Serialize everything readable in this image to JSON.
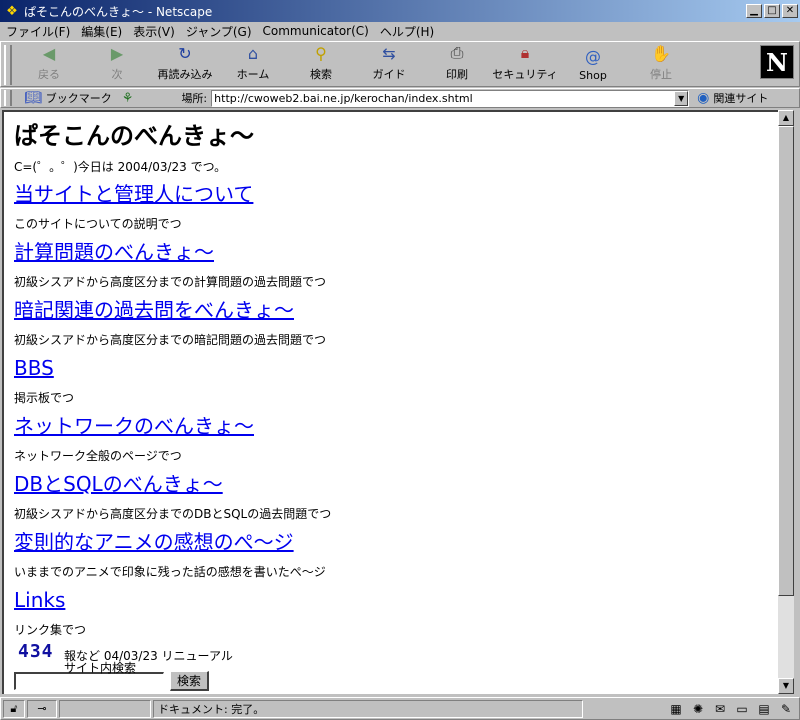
{
  "window": {
    "title": "ぱそこんのべんきょ～ - Netscape"
  },
  "menu": {
    "items": [
      "ファイル(F)",
      "編集(E)",
      "表示(V)",
      "ジャンプ(G)",
      "Communicator(C)",
      "ヘルプ(H)"
    ]
  },
  "toolbar": {
    "buttons": [
      {
        "label": "戻る",
        "icon": "back-arrow-icon",
        "enabled": false
      },
      {
        "label": "次",
        "icon": "forward-arrow-icon",
        "enabled": false
      },
      {
        "label": "再読み込み",
        "icon": "reload-icon",
        "enabled": true
      },
      {
        "label": "ホーム",
        "icon": "home-icon",
        "enabled": true
      },
      {
        "label": "検索",
        "icon": "search-icon",
        "enabled": true
      },
      {
        "label": "ガイド",
        "icon": "guide-icon",
        "enabled": true
      },
      {
        "label": "印刷",
        "icon": "print-icon",
        "enabled": true
      },
      {
        "label": "セキュリティ",
        "icon": "lock-icon",
        "enabled": true
      },
      {
        "label": "Shop",
        "icon": "shop-icon",
        "enabled": true
      },
      {
        "label": "停止",
        "icon": "stop-icon",
        "enabled": false
      }
    ],
    "logo_letter": "N"
  },
  "location": {
    "bookmarks_label": "ブックマーク",
    "location_label": "場所:",
    "url": "http://cwoweb2.bai.ne.jp/kerochan/index.shtml",
    "related_label": "関連サイト"
  },
  "page": {
    "title": "ぱそこんのべんきょ～",
    "date_line": "C=(゜。゜)今日は 2004/03/23 でつ。",
    "sections": [
      {
        "link": "当サイトと管理人について",
        "desc": "このサイトについての説明でつ"
      },
      {
        "link": "計算問題のべんきょ～",
        "desc": "初級シスアドから高度区分までの計算問題の過去問題でつ"
      },
      {
        "link": "暗記関連の過去問をべんきょ～",
        "desc": "初級シスアドから高度区分までの暗記問題の過去問題でつ"
      },
      {
        "link": "BBS",
        "desc": "掲示板でつ"
      },
      {
        "link": "ネットワークのべんきょ～",
        "desc": "ネットワーク全般のページでつ"
      },
      {
        "link": "DBとSQLのべんきょ～",
        "desc": "初級シスアドから高度区分までのDBとSQLの過去問題でつ"
      },
      {
        "link": "変則的なアニメの感想のぺ～ジ",
        "desc": "いままでのアニメで印象に残った話の感想を書いたぺ～ジ"
      },
      {
        "link": "Links",
        "desc": "リンク集でつ"
      }
    ],
    "counter": "434",
    "renewal_note": "報など 04/03/23  リニューアル",
    "search_label": "サイト内検索",
    "search_value": "",
    "search_button": "検索"
  },
  "status": {
    "text": "ドキュメント: 完了。"
  }
}
